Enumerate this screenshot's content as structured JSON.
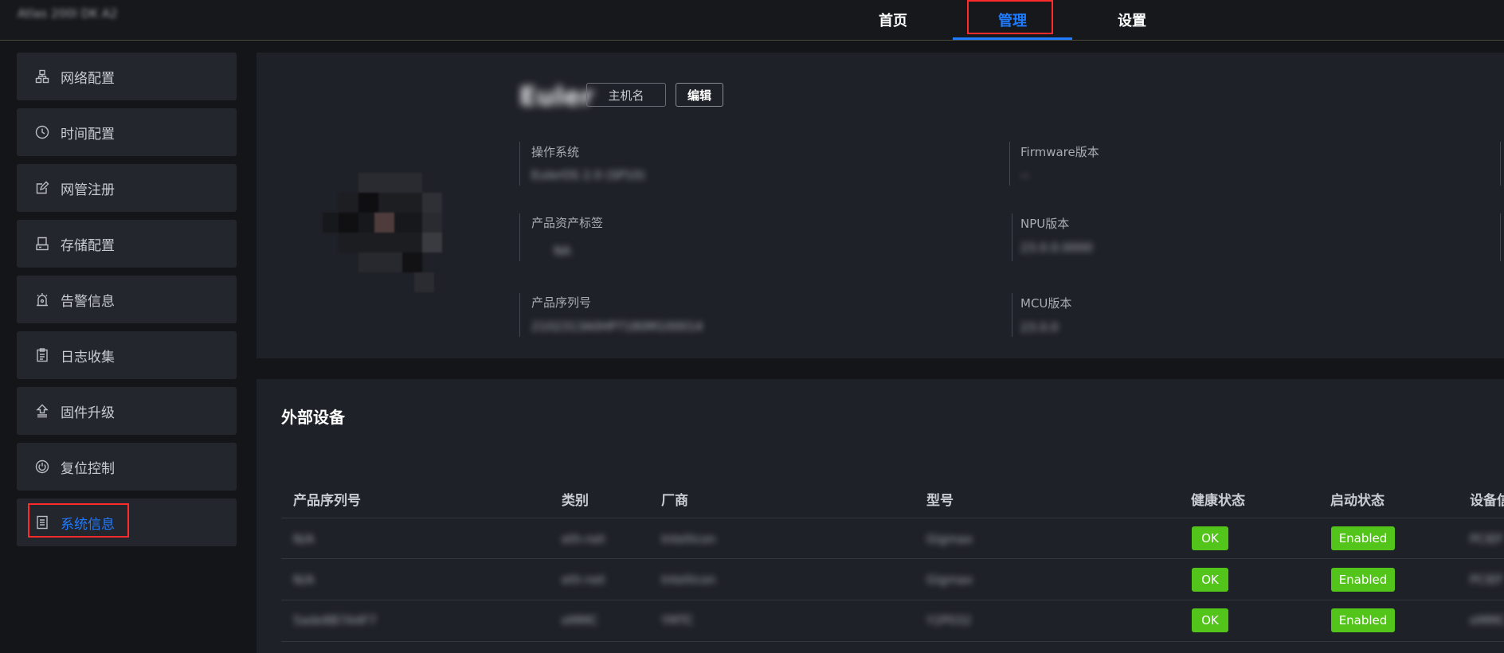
{
  "header": {
    "brand": "Atlas 200I DK A2",
    "nav": [
      "首页",
      "管理",
      "设置"
    ]
  },
  "sidebar": {
    "items": [
      {
        "label": "网络配置",
        "icon": "network-icon"
      },
      {
        "label": "时间配置",
        "icon": "clock-icon"
      },
      {
        "label": "网管注册",
        "icon": "register-icon"
      },
      {
        "label": "存储配置",
        "icon": "storage-icon"
      },
      {
        "label": "告警信息",
        "icon": "alarm-icon"
      },
      {
        "label": "日志收集",
        "icon": "clipboard-icon"
      },
      {
        "label": "固件升级",
        "icon": "upgrade-icon"
      },
      {
        "label": "复位控制",
        "icon": "power-icon"
      },
      {
        "label": "系统信息",
        "icon": "document-icon"
      }
    ]
  },
  "system": {
    "hostname": "Euler",
    "hostname_tag": "主机名",
    "edit_label": "编辑",
    "fields": [
      {
        "label": "操作系统",
        "value": "EulerOS 2.0 (SP10)"
      },
      {
        "label": "产品资产标签",
        "value": "NA"
      },
      {
        "label": "产品序列号",
        "value": "2102313A0HP7180M100014"
      },
      {
        "label": "Firmware版本",
        "value": "--"
      },
      {
        "label": "NPU版本",
        "value": "23.0.0.0000"
      },
      {
        "label": "MCU版本",
        "value": "23.0.0"
      }
    ]
  },
  "devices": {
    "title": "外部设备",
    "columns": [
      "产品序列号",
      "类别",
      "厂商",
      "型号",
      "健康状态",
      "启动状态",
      "设备信"
    ],
    "rows": [
      {
        "serial": "N/A",
        "type": "eth-net",
        "vendor": "Intellicon",
        "model": "Gigmax",
        "health": "OK",
        "state": "Enabled",
        "info": "PCIEF"
      },
      {
        "serial": "N/A",
        "type": "eth-net",
        "vendor": "Intellicon",
        "model": "Gigmax",
        "health": "OK",
        "state": "Enabled",
        "info": "PCIEF"
      },
      {
        "serial": "5ade8B7A4F7",
        "type": "eMMC",
        "vendor": "YMTC",
        "model": "Y2P032",
        "health": "OK",
        "state": "Enabled",
        "info": "eMMC"
      }
    ]
  },
  "colors": {
    "accent": "#1f7bff",
    "ok": "#52c41a",
    "highlight": "#ff2b2b"
  }
}
